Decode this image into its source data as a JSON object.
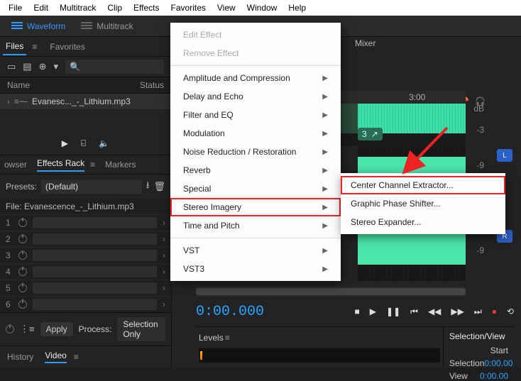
{
  "menubar": [
    "File",
    "Edit",
    "Multitrack",
    "Clip",
    "Effects",
    "Favorites",
    "View",
    "Window",
    "Help"
  ],
  "modes": {
    "waveform": "Waveform",
    "multitrack": "Multitrack"
  },
  "files_panel": {
    "tabs": {
      "files": "Files",
      "favorites": "Favorites"
    },
    "header": {
      "name": "Name",
      "status": "Status"
    },
    "items": [
      {
        "label": "Evanesc..._-_Lithium.mp3"
      }
    ]
  },
  "mixer_tab": "Mixer",
  "fx_panel": {
    "tabs": {
      "browser": "owser",
      "rack": "Effects Rack",
      "markers": "Markers"
    },
    "presets_label": "Presets:",
    "preset_value": "(Default)",
    "file_label": "File: Evanescence_-_Lithium.mp3",
    "slots": [
      "1",
      "2",
      "3",
      "4",
      "5",
      "6"
    ],
    "apply": "Apply",
    "process_label": "Process:",
    "process_value": "Selection Only"
  },
  "hist_tabs": {
    "history": "History",
    "video": "Video"
  },
  "ruler": {
    "t1": "3:00"
  },
  "db_axis": {
    "unit": "dB",
    "vals": [
      "-3",
      "-9",
      "-3",
      "-9"
    ]
  },
  "lr": {
    "l": "L",
    "r": "R"
  },
  "badge": {
    "a": "3",
    "b": "↗"
  },
  "timecode": "0:00.000",
  "levels": {
    "title": "Levels"
  },
  "selview": {
    "title": "Selection/View",
    "start": "Start",
    "selection": "Selection",
    "view": "View",
    "v1": "0:00.00",
    "v2": "0:00.00"
  },
  "fx_menu": {
    "edit": "Edit Effect",
    "remove": "Remove Effect",
    "items": [
      "Amplitude and Compression",
      "Delay and Echo",
      "Filter and EQ",
      "Modulation",
      "Noise Reduction / Restoration",
      "Reverb",
      "Special",
      "Stereo Imagery",
      "Time and Pitch"
    ],
    "vst": "VST",
    "vst3": "VST3"
  },
  "sub_menu": {
    "items": [
      "Center Channel Extractor...",
      "Graphic Phase Shifter...",
      "Stereo Expander..."
    ]
  }
}
